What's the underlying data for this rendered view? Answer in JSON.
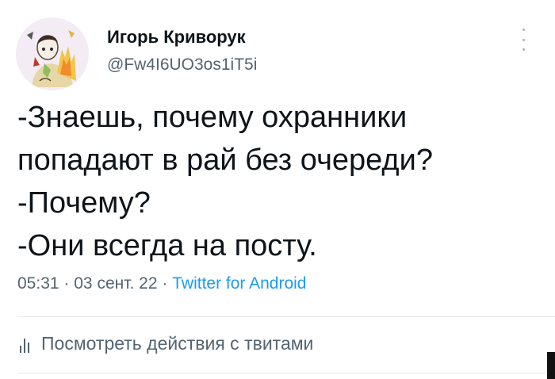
{
  "author": {
    "name": "Игорь Криворук",
    "handle": "@Fw4I6UO3os1iT5i",
    "avatar_icon": "avatar-drawing-icon"
  },
  "tweet": {
    "lines": [
      "-Знаешь, почему охранники",
      "попадают в рай без очереди?",
      "-Почему?",
      "-Они всегда на посту."
    ]
  },
  "meta": {
    "time": "05:31",
    "separator": "·",
    "date": "03 сент. 22",
    "source": "Twitter for Android"
  },
  "actions": {
    "analytics_label": "Посмотреть действия с твитами",
    "analytics_icon": "bar-chart-icon",
    "more_icon": "more-options-icon"
  },
  "colors": {
    "text": "#0f1419",
    "secondary": "#536471",
    "link": "#1d9bf0",
    "divider": "#e7e9ea"
  }
}
